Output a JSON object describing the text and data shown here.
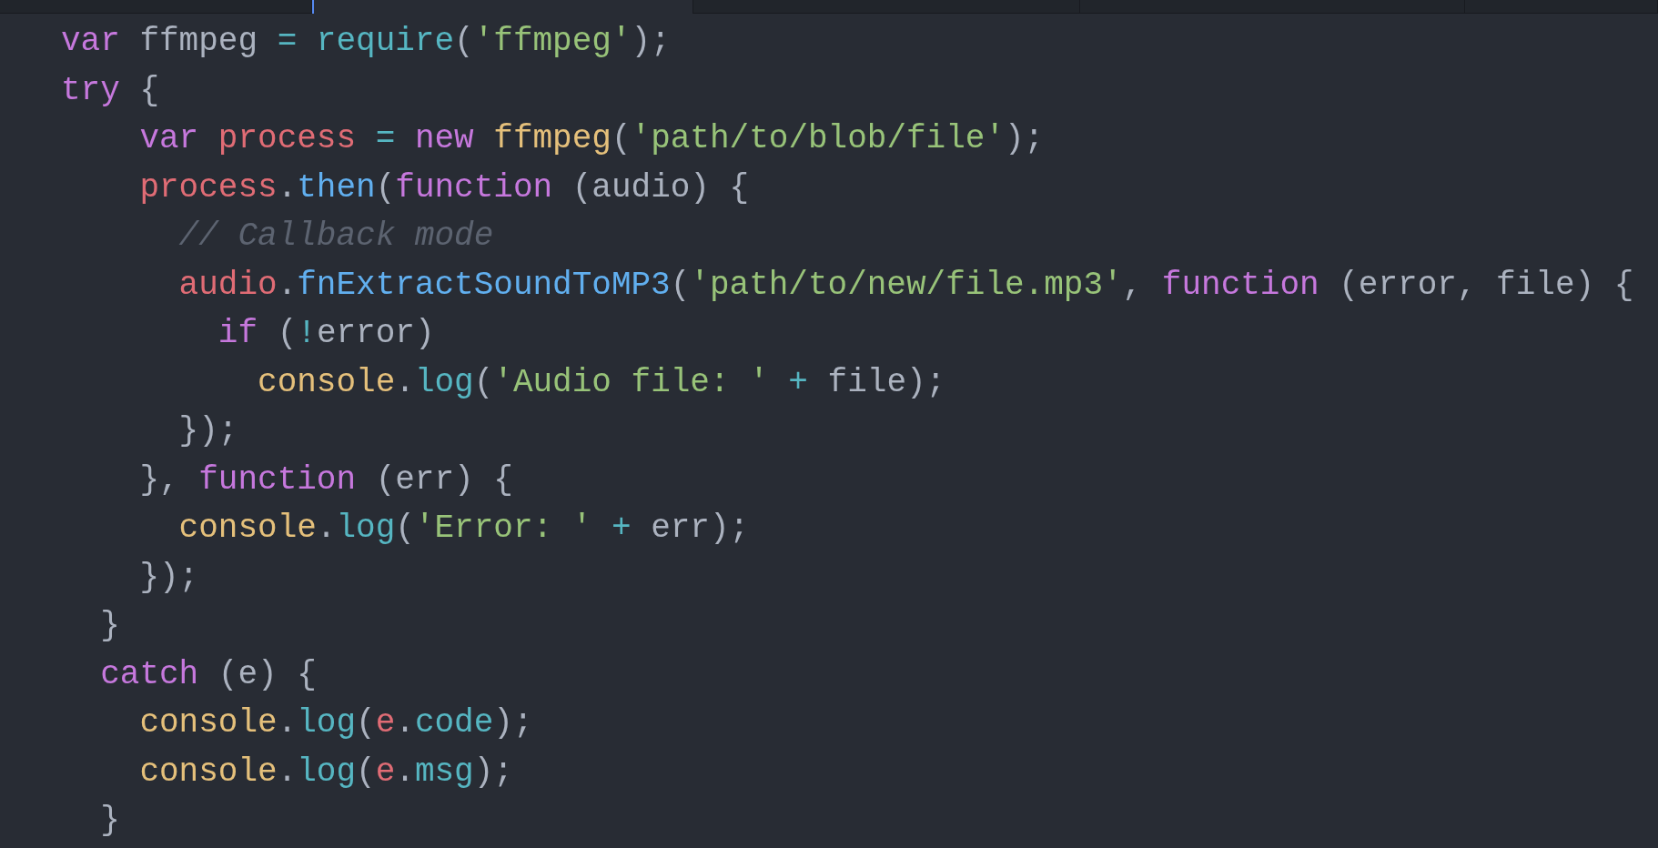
{
  "tabs": [
    {
      "selected": false
    },
    {
      "selected": true
    },
    {
      "selected": false
    },
    {
      "selected": false
    },
    {
      "selected": false
    }
  ],
  "code_lines": [
    [
      {
        "kind": "keyword",
        "text": "var"
      },
      {
        "kind": "plain",
        "text": " ffmpeg "
      },
      {
        "kind": "operator",
        "text": "="
      },
      {
        "kind": "builtin",
        "text": " require"
      },
      {
        "kind": "punct",
        "text": "("
      },
      {
        "kind": "string",
        "text": "'ffmpeg'"
      },
      {
        "kind": "punct",
        "text": ");"
      }
    ],
    [
      {
        "kind": "keyword",
        "text": "try"
      },
      {
        "kind": "punct",
        "text": " {"
      }
    ],
    [
      {
        "kind": "keyword",
        "text": "    var"
      },
      {
        "kind": "variable",
        "text": " process"
      },
      {
        "kind": "operator",
        "text": " ="
      },
      {
        "kind": "keyword",
        "text": " new"
      },
      {
        "kind": "type",
        "text": " ffmpeg"
      },
      {
        "kind": "punct",
        "text": "("
      },
      {
        "kind": "string",
        "text": "'path/to/blob/file'"
      },
      {
        "kind": "punct",
        "text": ");"
      }
    ],
    [
      {
        "kind": "variable",
        "text": "    process"
      },
      {
        "kind": "punct",
        "text": "."
      },
      {
        "kind": "method",
        "text": "then"
      },
      {
        "kind": "punct",
        "text": "("
      },
      {
        "kind": "keyword",
        "text": "function"
      },
      {
        "kind": "punct",
        "text": " (audio) {"
      }
    ],
    [
      {
        "kind": "comment",
        "text": "      // Callback mode"
      }
    ],
    [
      {
        "kind": "variable",
        "text": "      audio"
      },
      {
        "kind": "punct",
        "text": "."
      },
      {
        "kind": "method",
        "text": "fnExtractSoundToMP3"
      },
      {
        "kind": "punct",
        "text": "("
      },
      {
        "kind": "string",
        "text": "'path/to/new/file.mp3'"
      },
      {
        "kind": "punct",
        "text": ", "
      },
      {
        "kind": "keyword",
        "text": "function"
      },
      {
        "kind": "punct",
        "text": " (error, file) {"
      }
    ],
    [
      {
        "kind": "keyword",
        "text": "        if"
      },
      {
        "kind": "punct",
        "text": " ("
      },
      {
        "kind": "operator",
        "text": "!"
      },
      {
        "kind": "punct",
        "text": "error)"
      }
    ],
    [
      {
        "kind": "type",
        "text": "          console"
      },
      {
        "kind": "punct",
        "text": "."
      },
      {
        "kind": "builtin",
        "text": "log"
      },
      {
        "kind": "punct",
        "text": "("
      },
      {
        "kind": "string",
        "text": "'Audio file: '"
      },
      {
        "kind": "operator",
        "text": " +"
      },
      {
        "kind": "punct",
        "text": " file);"
      }
    ],
    [
      {
        "kind": "punct",
        "text": "      });"
      }
    ],
    [
      {
        "kind": "punct",
        "text": "    }, "
      },
      {
        "kind": "keyword",
        "text": "function"
      },
      {
        "kind": "punct",
        "text": " (err) {"
      }
    ],
    [
      {
        "kind": "type",
        "text": "      console"
      },
      {
        "kind": "punct",
        "text": "."
      },
      {
        "kind": "builtin",
        "text": "log"
      },
      {
        "kind": "punct",
        "text": "("
      },
      {
        "kind": "string",
        "text": "'Error: '"
      },
      {
        "kind": "operator",
        "text": " +"
      },
      {
        "kind": "punct",
        "text": " err);"
      }
    ],
    [
      {
        "kind": "punct",
        "text": "    });"
      }
    ],
    [
      {
        "kind": "punct",
        "text": "  }"
      }
    ],
    [
      {
        "kind": "keyword",
        "text": "  catch"
      },
      {
        "kind": "punct",
        "text": " (e) {"
      }
    ],
    [
      {
        "kind": "type",
        "text": "    console"
      },
      {
        "kind": "punct",
        "text": "."
      },
      {
        "kind": "builtin",
        "text": "log"
      },
      {
        "kind": "punct",
        "text": "("
      },
      {
        "kind": "variable",
        "text": "e"
      },
      {
        "kind": "punct",
        "text": "."
      },
      {
        "kind": "builtin",
        "text": "code"
      },
      {
        "kind": "punct",
        "text": ");"
      }
    ],
    [
      {
        "kind": "type",
        "text": "    console"
      },
      {
        "kind": "punct",
        "text": "."
      },
      {
        "kind": "builtin",
        "text": "log"
      },
      {
        "kind": "punct",
        "text": "("
      },
      {
        "kind": "variable",
        "text": "e"
      },
      {
        "kind": "punct",
        "text": "."
      },
      {
        "kind": "builtin",
        "text": "msg"
      },
      {
        "kind": "punct",
        "text": ");"
      }
    ],
    [
      {
        "kind": "punct",
        "text": "  }"
      }
    ]
  ]
}
